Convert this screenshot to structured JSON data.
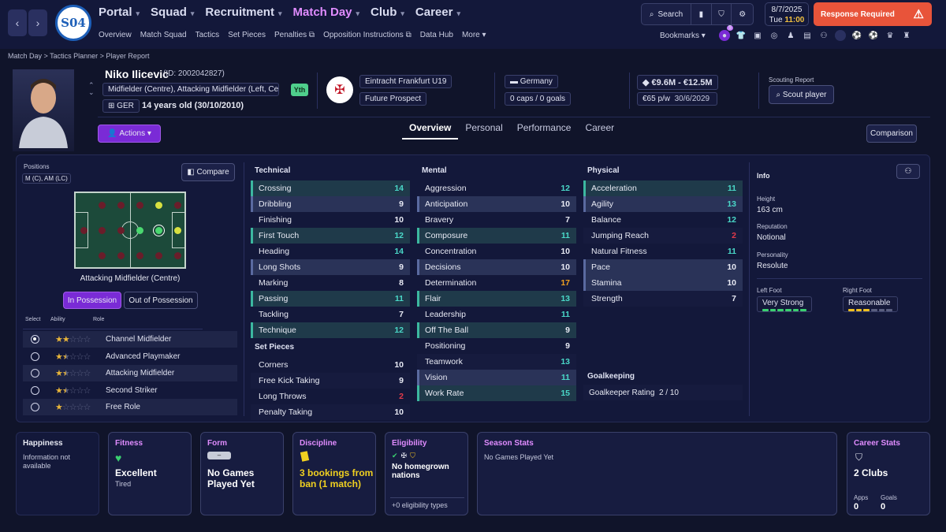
{
  "nav": {
    "main": [
      "Portal",
      "Squad",
      "Recruitment",
      "Match Day",
      "Club",
      "Career"
    ],
    "active": "Match Day",
    "sub": [
      "Overview",
      "Match Squad",
      "Tactics",
      "Set Pieces",
      "Penalties",
      "Opposition Instructions",
      "Data Hub",
      "More"
    ],
    "club_crest_text": "S04",
    "search": "Search",
    "date": "8/7/2025",
    "day": "Tue",
    "time": "11:00",
    "response": "Response Required",
    "bookmarks": "Bookmarks",
    "bookmark_badge": "5"
  },
  "breadcrumb": [
    "Match Day",
    "Tactics Planner",
    "Player Report"
  ],
  "player": {
    "name": "Niko Ilicevic",
    "id": "(ID: 2002042827)",
    "position": "Midfielder (Centre), Attacking Midfielder (Left, Ce...",
    "nation_code": "GER",
    "age": "14 years old (30/10/2010)",
    "tag": "Yth",
    "club": "Eintracht Frankfurt U19",
    "status": "Future Prospect",
    "country": "Germany",
    "caps": "0 caps / 0 goals",
    "value": "€9.6M - €12.5M",
    "wage": "€65 p/w",
    "contract": "30/6/2029",
    "scouting_label": "Scouting Report",
    "scout_btn": "Scout player",
    "actions": "Actions",
    "comparison": "Comparison"
  },
  "tabs": [
    "Overview",
    "Personal",
    "Performance",
    "Career"
  ],
  "positions": {
    "label": "Positions",
    "value": "M (C), AM (LC)",
    "compare": "Compare",
    "selected_role": "Attacking Midfielder (Centre)",
    "in_possession": "In Possession",
    "out_possession": "Out of Possession",
    "col_select": "Select",
    "col_ability": "Ability",
    "col_role": "Role",
    "roles": [
      {
        "name": "Channel Midfielder",
        "stars": 2,
        "selected": true
      },
      {
        "name": "Advanced Playmaker",
        "stars": 1.5,
        "selected": false
      },
      {
        "name": "Attacking Midfielder",
        "stars": 1.5,
        "selected": false
      },
      {
        "name": "Second Striker",
        "stars": 1.5,
        "selected": false
      },
      {
        "name": "Free Role",
        "stars": 1,
        "selected": false
      }
    ]
  },
  "technical": {
    "title": "Technical",
    "rows": [
      [
        "Crossing",
        "14"
      ],
      [
        "Dribbling",
        "9"
      ],
      [
        "Finishing",
        "10"
      ],
      [
        "First Touch",
        "12"
      ],
      [
        "Heading",
        "14"
      ],
      [
        "Long Shots",
        "9"
      ],
      [
        "Marking",
        "8"
      ],
      [
        "Passing",
        "11"
      ],
      [
        "Tackling",
        "7"
      ],
      [
        "Technique",
        "12"
      ]
    ]
  },
  "set_pieces": {
    "title": "Set Pieces",
    "rows": [
      [
        "Corners",
        "10"
      ],
      [
        "Free Kick Taking",
        "9"
      ],
      [
        "Long Throws",
        "2"
      ],
      [
        "Penalty Taking",
        "10"
      ]
    ]
  },
  "mental": {
    "title": "Mental",
    "rows": [
      [
        "Aggression",
        "12"
      ],
      [
        "Anticipation",
        "10"
      ],
      [
        "Bravery",
        "7"
      ],
      [
        "Composure",
        "11"
      ],
      [
        "Concentration",
        "10"
      ],
      [
        "Decisions",
        "10"
      ],
      [
        "Determination",
        "17"
      ],
      [
        "Flair",
        "13"
      ],
      [
        "Leadership",
        "11"
      ],
      [
        "Off The Ball",
        "9"
      ],
      [
        "Positioning",
        "9"
      ],
      [
        "Teamwork",
        "13"
      ],
      [
        "Vision",
        "11"
      ],
      [
        "Work Rate",
        "15"
      ]
    ]
  },
  "physical": {
    "title": "Physical",
    "rows": [
      [
        "Acceleration",
        "11"
      ],
      [
        "Agility",
        "13"
      ],
      [
        "Balance",
        "12"
      ],
      [
        "Jumping Reach",
        "2"
      ],
      [
        "Natural Fitness",
        "11"
      ],
      [
        "Pace",
        "10"
      ],
      [
        "Stamina",
        "10"
      ],
      [
        "Strength",
        "7"
      ]
    ]
  },
  "goalkeeping": {
    "title": "Goalkeeping",
    "rating": "Goalkeeper Rating",
    "value": "2 / 10"
  },
  "info": {
    "title": "Info",
    "height_l": "Height",
    "height": "163 cm",
    "rep_l": "Reputation",
    "rep": "Notional",
    "pers_l": "Personality",
    "pers": "Resolute",
    "lf_l": "Left Foot",
    "lf": "Very Strong",
    "rf_l": "Right Foot",
    "rf": "Reasonable"
  },
  "cards": {
    "happiness_t": "Happiness",
    "happiness": "Information not available",
    "fitness_t": "Fitness",
    "fitness": "Excellent",
    "fitness_sub": "Tired",
    "form_t": "Form",
    "form": "No Games Played Yet",
    "discipline_t": "Discipline",
    "discipline": "3 bookings from ban (1 match)",
    "elig_t": "Eligibility",
    "elig": "No homegrown nations",
    "elig_sub": "+0 eligibility types",
    "season_t": "Season Stats",
    "season": "No Games Played Yet",
    "career_t": "Career Stats",
    "career": "2 Clubs",
    "apps_l": "Apps",
    "apps": "0",
    "goals_l": "Goals",
    "goals": "0"
  },
  "colors": {
    "accent": "#e08cff",
    "purple_btn": "#7a2bd6",
    "high": "#4ad8c8",
    "low": "#e23a4a",
    "gold": "#f0a020"
  }
}
